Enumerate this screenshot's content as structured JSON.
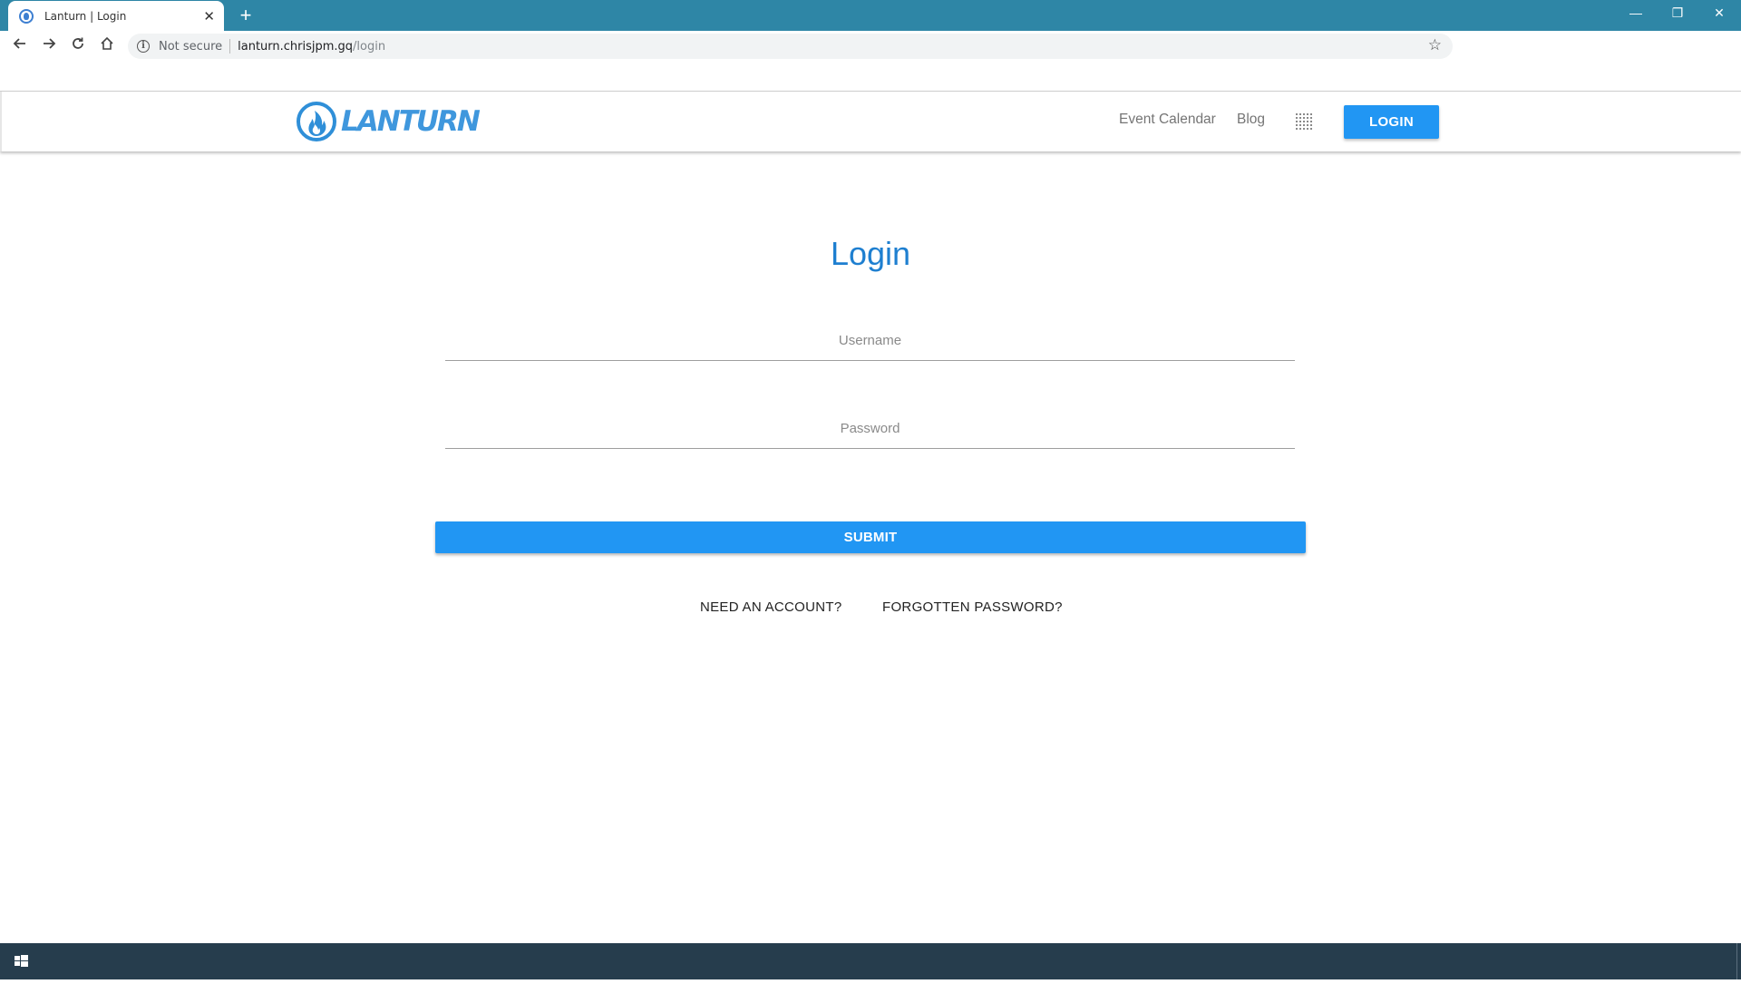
{
  "browser": {
    "tab_title": "Lanturn  |  Login",
    "tab_close": "✕",
    "new_tab": "+",
    "minimize": "—",
    "restore": "❐",
    "close": "✕",
    "security_label": "Not secure",
    "url_host": "lanturn.chrisjpm.gq",
    "url_path": "/login"
  },
  "header": {
    "logo_text": "LANTURN",
    "nav": {
      "event_calendar": "Event Calendar",
      "blog": "Blog"
    },
    "login_button": "LOGIN"
  },
  "login": {
    "title": "Login",
    "username_placeholder": "Username",
    "password_placeholder": "Password",
    "submit": "SUBMIT",
    "need_account": "NEED AN ACCOUNT?",
    "forgotten_password": "FORGOTTEN PASSWORD?"
  },
  "colors": {
    "tabstrip": "#2e86a6",
    "brand_blue": "#2196f3",
    "title_blue": "#1e7fd0",
    "taskbar": "#263d4d"
  }
}
